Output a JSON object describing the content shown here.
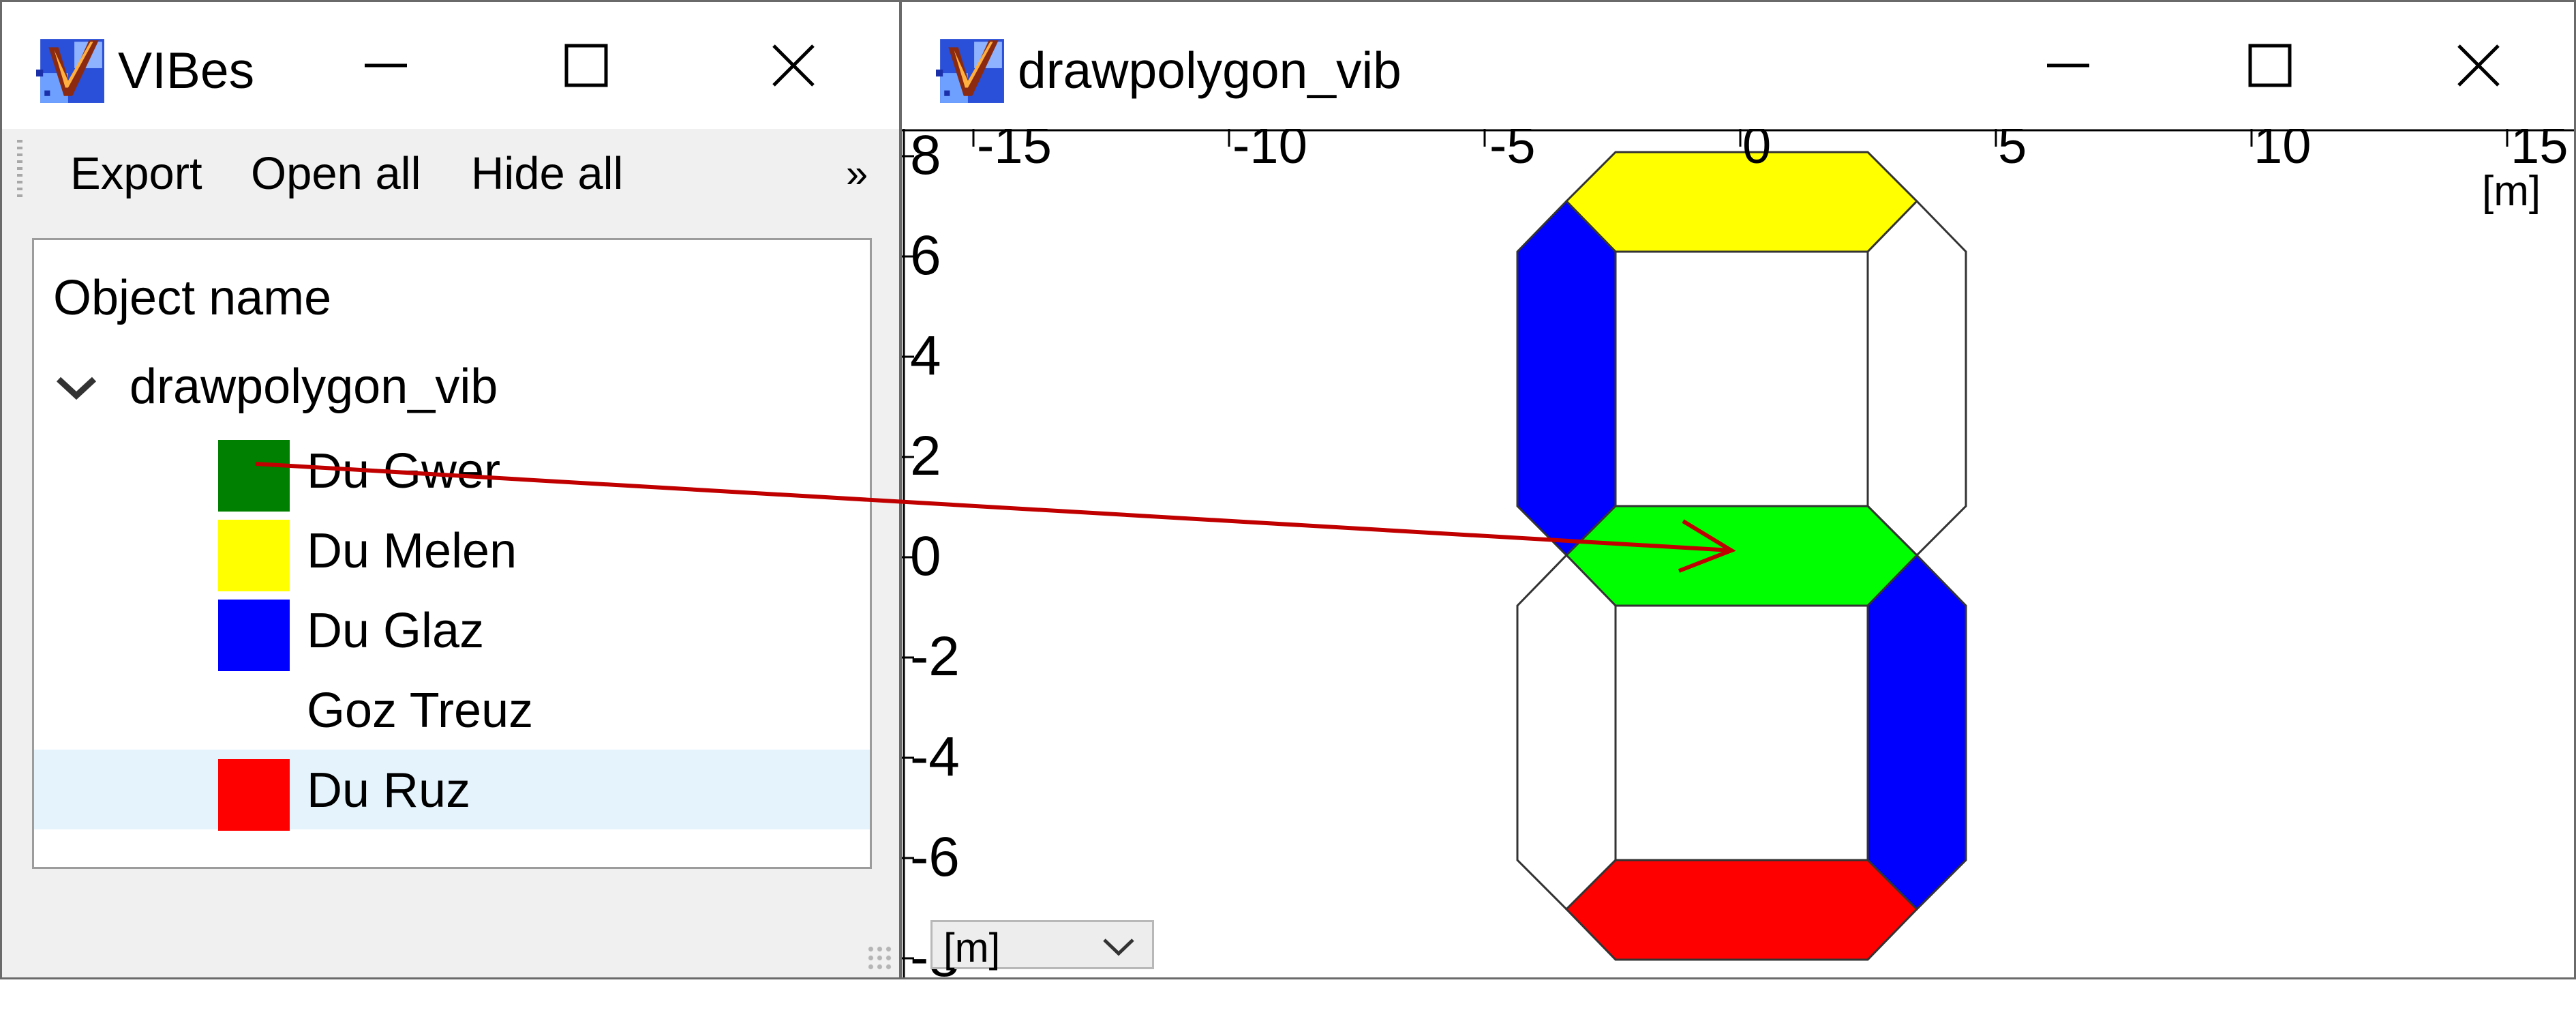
{
  "left_window": {
    "title": "VIBes",
    "toolbar": {
      "export": "Export",
      "open_all": "Open all",
      "hide_all": "Hide all",
      "overflow": "»"
    },
    "tree": {
      "header": "Object name",
      "root": "drawpolygon_vib",
      "items": [
        {
          "label": "Du Gwer",
          "color": "#008000"
        },
        {
          "label": "Du Melen",
          "color": "#ffff00"
        },
        {
          "label": "Du Glaz",
          "color": "#0000ff"
        },
        {
          "label": "Goz Treuz",
          "color": ""
        },
        {
          "label": "Du Ruz",
          "color": "#ff0000",
          "selected": true
        }
      ]
    }
  },
  "right_window": {
    "title": "drawpolygon_vib",
    "unit_select": "[m]",
    "plot": {
      "x_ticks": [
        "-15",
        "-10",
        "-5",
        "0",
        "5",
        "10",
        "15"
      ],
      "x_unit": "[m]",
      "y_ticks": [
        "8",
        "6",
        "4",
        "2",
        "0",
        "-2",
        "-4",
        "-6",
        "-8"
      ],
      "segments": [
        {
          "name": "top",
          "color": "#ffff00"
        },
        {
          "name": "upper-left",
          "color": "#0000ff"
        },
        {
          "name": "upper-right",
          "color": "#ffffff"
        },
        {
          "name": "middle",
          "color": "#00ff00"
        },
        {
          "name": "lower-left",
          "color": "#ffffff"
        },
        {
          "name": "lower-right",
          "color": "#0000ff"
        },
        {
          "name": "bottom",
          "color": "#ff0000"
        }
      ]
    }
  },
  "annotation": {
    "arrow_color": "#c00000"
  }
}
